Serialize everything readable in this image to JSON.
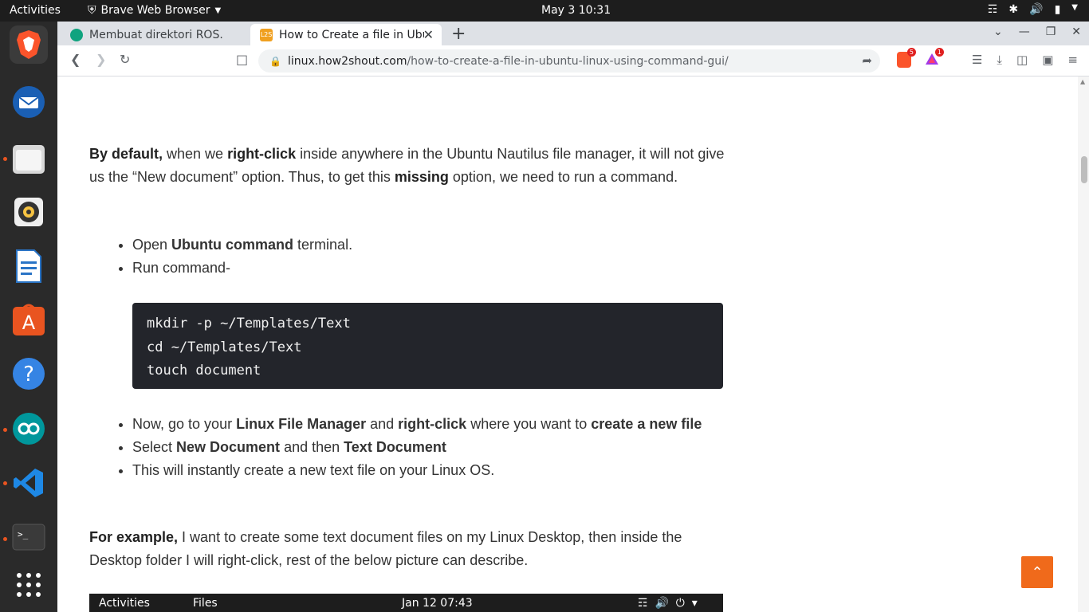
{
  "topbar": {
    "activities": "Activities",
    "app_name": "Brave Web Browser",
    "clock": "May 3  10:31"
  },
  "dock": {
    "apps": [
      "brave-icon",
      "thunderbird-icon",
      "files-icon",
      "rhythmbox-icon",
      "libreoffice-writer-icon",
      "software-center-icon",
      "help-icon",
      "arduino-icon",
      "vscode-icon",
      "terminal-icon"
    ],
    "apps_grid_icon": "show-applications-icon"
  },
  "browser": {
    "tabs": [
      {
        "title": "Membuat direktori ROS."
      },
      {
        "title": "How to Create a file in Ubu"
      }
    ],
    "url_host": "linux.how2shout.com",
    "url_path": "/how-to-create-a-file-in-ubuntu-linux-using-command-gui/",
    "shield_count": "5",
    "rewards_count": "1"
  },
  "article": {
    "p1_b1": "By default,",
    "p1_t1": " when we ",
    "p1_b2": "right-click",
    "p1_t2": " inside anywhere in the Ubuntu Nautilus file manager, it will not give us the “New document” option. Thus, to get this ",
    "p1_b3": "missing",
    "p1_t3": " option, we need to run a command.",
    "list1": {
      "i1_t1": "Open ",
      "i1_b1": "Ubuntu command",
      "i1_t2": " terminal.",
      "i2": "Run command-"
    },
    "code_lines": {
      "l1": "mkdir -p ~/Templates/Text",
      "l2": "cd ~/Templates/Text",
      "l3": "touch document"
    },
    "list2": {
      "i1_t1": "Now, go to your ",
      "i1_b1": "Linux File Manager",
      "i1_t2": " and ",
      "i1_b2": "right-click",
      "i1_t3": " where you want to ",
      "i1_b3": "create a new file",
      "i2_t1": "Select ",
      "i2_b1": "New Document",
      "i2_t2": " and then ",
      "i2_b2": "Text Document",
      "i3": "This will instantly create a new text file on your Linux OS."
    },
    "p2_b1": "For example,",
    "p2_t1": " I want to create some text document files on my Linux Desktop, then inside the Desktop folder I will right-click, rest of the below picture can describe."
  },
  "embedded_screenshot": {
    "activities": "Activities",
    "files": "Files",
    "clock": "Jan 12  07:43"
  }
}
